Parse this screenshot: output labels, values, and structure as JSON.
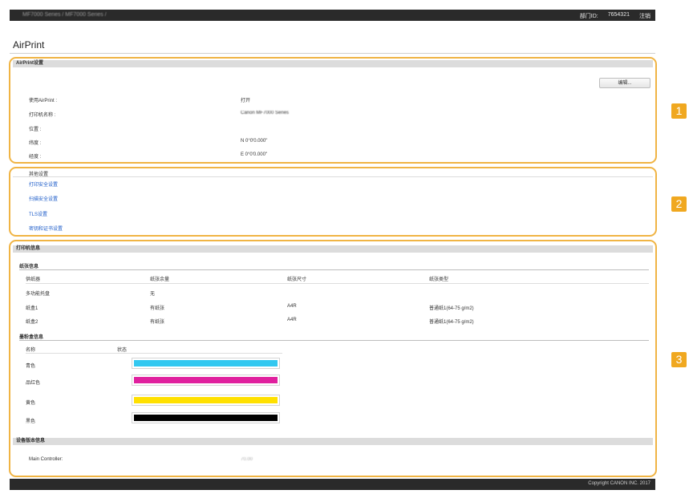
{
  "topbar": {
    "device": "MF7000 Series / MF7000 Series /",
    "user": "部门ID:",
    "user_id": "7654321",
    "logout": "注销"
  },
  "title": "AirPrint",
  "section1": {
    "header": "AirPrint设置",
    "edit_button": "编辑...",
    "rows": [
      {
        "label": "使用AirPrint :",
        "value": "打开"
      },
      {
        "label": "打印机名称 :",
        "value": "Canon MF7000 Series"
      },
      {
        "label": "位置 :",
        "value": ""
      },
      {
        "label": "纬度 :",
        "value": "N 0°0'0.000\""
      },
      {
        "label": "经度 :",
        "value": "E 0°0'0.000\""
      }
    ]
  },
  "section2": {
    "header": "其他设置",
    "links": [
      "打印安全设置",
      "扫描安全设置",
      "TLS设置",
      "密钥和证书设置"
    ]
  },
  "section3": {
    "header": "打印机信息",
    "paper": {
      "title": "纸张信息",
      "columns": [
        "供纸器",
        "纸张余量",
        "纸张尺寸",
        "纸张类型"
      ],
      "rows": [
        [
          "多功能托盘",
          "无",
          "",
          ""
        ],
        [
          "纸盒1",
          "有纸张",
          "A4R",
          "普通纸1(64-75 g/m2)"
        ],
        [
          "纸盒2",
          "有纸张",
          "A4R",
          "普通纸1(64-75 g/m2)"
        ]
      ]
    },
    "toner": {
      "title": "墨粉盒信息",
      "columns": [
        "名称",
        "状态"
      ],
      "items": [
        {
          "name": "青色",
          "color": "#33c8f0"
        },
        {
          "name": "品红色",
          "color": "#e0209e"
        },
        {
          "name": "黄色",
          "color": "#ffe000"
        },
        {
          "name": "黑色",
          "color": "#000000"
        }
      ]
    },
    "device_version": {
      "title": "设备版本信息",
      "label": "Main Controller:",
      "value": "70.00"
    }
  },
  "badges": [
    "1",
    "2",
    "3"
  ],
  "footer": {
    "copyright": "Copyright CANON INC. 2017"
  }
}
